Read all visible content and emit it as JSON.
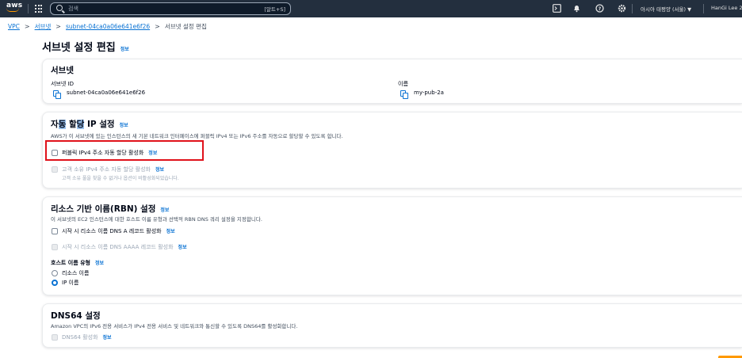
{
  "topnav": {
    "logo": "aws",
    "search_placeholder": "검색",
    "search_shortcut": "[알트+S]",
    "region": "아시아 태평양 (서울) ▼",
    "user": "HanGi Lee 2"
  },
  "breadcrumb": {
    "vpc": "VPC",
    "subnets": "서브넷",
    "subnet_id": "subnet-04ca0a06e641e6f26",
    "current": "서브넷 설정 편집",
    "sep": ">"
  },
  "page": {
    "title": "서브넷 설정 편집",
    "info": "정보"
  },
  "subnet_card": {
    "title": "서브넷",
    "subnet_id_label": "서브넷 ID",
    "subnet_id_value": "subnet-04ca0a06e641e6f26",
    "name_label": "이름",
    "name_value": "my-pub-2a"
  },
  "auto_ip_card": {
    "title_part1": "자",
    "title_part2": "동",
    "title_part3": " 할",
    "title_part4": "당",
    "title_part5": " IP 설정",
    "info": "정보",
    "desc": "AWS가 이 서브넷에 있는 인스턴스의 새 기본 네트워크 인터페이스에 퍼블릭 IPv4 또는 IPv6 주소를 자동으로 할당할 수 있도록 합니다.",
    "public_ipv4_label": "퍼블릭 IPv4 주소 자동 할당 활성화",
    "public_ipv4_info": "정보",
    "customer_ipv4_label": "고객 소유 IPv4 주소 자동 할당 활성화",
    "customer_ipv4_info": "정보",
    "customer_ipv4_sub": "고객 소유 풀을 찾을 수 없거나 옵션이 비활성화되었습니다."
  },
  "rbn_card": {
    "title": "리소스 기반 이름(RBN) 설정",
    "info": "정보",
    "desc": "이 서브넷의 EC2 인스턴스에 대한 호스트 이름 유형과 선택적 RBN DNS 쿼리 설정을 지정합니다.",
    "dns_a_label": "시작 시 리소스 이름 DNS A 레코드 활성화",
    "dns_a_info": "정보",
    "dns_aaaa_label": "시작 시 리소스 이름 DNS AAAA 레코드 활성화",
    "dns_aaaa_info": "정보",
    "hostname_type_label": "호스트 이름 유형",
    "hostname_type_info": "정보",
    "option_resource": "리소스 이름",
    "option_ip": "IP 이름"
  },
  "dns64_card": {
    "title": "DNS64 설정",
    "desc": "Amazon VPC의 IPv6 전용 서비스가 IPv4 전용 서비스 및 네트워크와 통신할 수 있도록 DNS64를 활성화합니다.",
    "dns64_label": "DNS64 활성화",
    "dns64_info": "정보"
  },
  "colors": {
    "nav_bg": "#232f3e",
    "link": "#0972d3",
    "highlight": "#e0121b",
    "accent": "#ff9900"
  }
}
